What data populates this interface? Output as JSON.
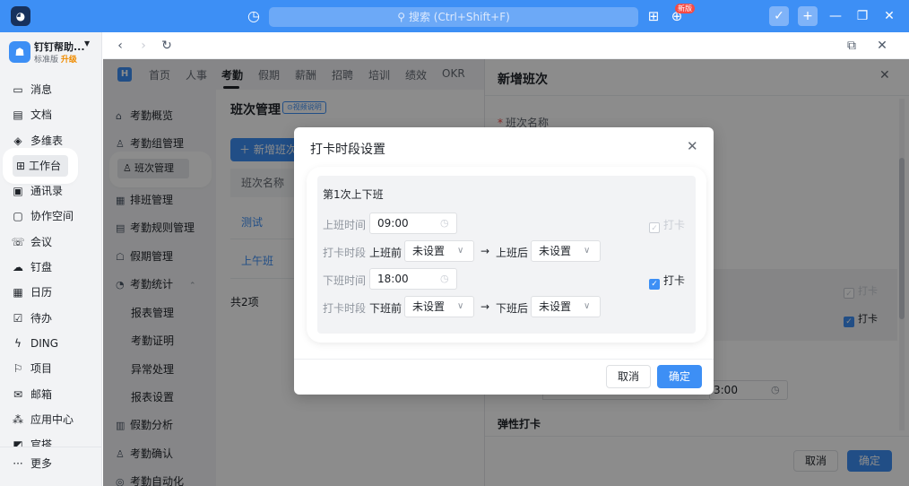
{
  "titlebar": {
    "search_placeholder": "搜索 (Ctrl+Shift+F)",
    "new_badge": "新版",
    "accent": "#3d8ff5"
  },
  "org": {
    "name": "钉钉帮助...",
    "edition": "标准版",
    "upgrade": "升级"
  },
  "rail": {
    "items": [
      {
        "label": "消息",
        "icon": "message-icon"
      },
      {
        "label": "文档",
        "icon": "document-icon"
      },
      {
        "label": "多维表",
        "icon": "table-icon"
      },
      {
        "label": "工作台",
        "icon": "workbench-icon"
      },
      {
        "label": "通讯录",
        "icon": "contacts-icon"
      },
      {
        "label": "协作空间",
        "icon": "workspace-icon"
      },
      {
        "label": "会议",
        "icon": "meeting-icon"
      },
      {
        "label": "钉盘",
        "icon": "drive-icon"
      },
      {
        "label": "日历",
        "icon": "calendar-icon"
      },
      {
        "label": "待办",
        "icon": "todo-icon"
      },
      {
        "label": "DING",
        "icon": "ding-icon"
      },
      {
        "label": "项目",
        "icon": "project-icon"
      },
      {
        "label": "邮箱",
        "icon": "mail-icon"
      },
      {
        "label": "应用中心",
        "icon": "apps-icon"
      },
      {
        "label": "官搭",
        "icon": "build-icon"
      },
      {
        "label": "更多",
        "icon": "more-icon"
      }
    ]
  },
  "app_tabs": [
    "首页",
    "人事",
    "考勤",
    "假期",
    "薪酬",
    "招聘",
    "培训",
    "绩效",
    "OKR"
  ],
  "side_nav": {
    "items": [
      {
        "label": "考勤概览",
        "icon": "home-icon"
      },
      {
        "label": "考勤组管理",
        "icon": "group-icon"
      },
      {
        "label": "班次管理",
        "icon": "shift-icon"
      },
      {
        "label": "排班管理",
        "icon": "schedule-icon"
      },
      {
        "label": "考勤规则管理",
        "icon": "rules-icon"
      },
      {
        "label": "假期管理",
        "icon": "holiday-icon"
      },
      {
        "label": "考勤统计",
        "icon": "stats-icon"
      },
      {
        "label": "报表管理",
        "icon": ""
      },
      {
        "label": "考勤证明",
        "icon": ""
      },
      {
        "label": "异常处理",
        "icon": ""
      },
      {
        "label": "报表设置",
        "icon": ""
      },
      {
        "label": "假勤分析",
        "icon": "analysis-icon"
      },
      {
        "label": "考勤确认",
        "icon": "confirm-icon"
      },
      {
        "label": "考勤自动化",
        "icon": "auto-icon"
      }
    ]
  },
  "content": {
    "title": "班次管理",
    "video_tag": "视频说明",
    "add_button": "新增班次",
    "column": "班次名称",
    "rows": [
      "测试",
      "上午班"
    ],
    "total": "共2项"
  },
  "drawer": {
    "title": "新增班次",
    "field_label": "班次名称",
    "check_label": "打卡",
    "time_partial": "3:00",
    "section": "弹性打卡",
    "cancel": "取消",
    "ok": "确定"
  },
  "modal": {
    "title": "打卡时段设置",
    "panel_heading": "第1次上下班",
    "on_time_label": "上班时间",
    "on_time_value": "09:00",
    "on_check_label": "打卡",
    "on_range_label": "打卡时段",
    "before_on": "上班前",
    "after_on": "上班后",
    "off_time_label": "下班时间",
    "off_time_value": "18:00",
    "off_check_label": "打卡",
    "off_range_label": "打卡时段",
    "before_off": "下班前",
    "after_off": "下班后",
    "not_set": "未设置",
    "arrow": "→",
    "cancel": "取消",
    "ok": "确定"
  }
}
